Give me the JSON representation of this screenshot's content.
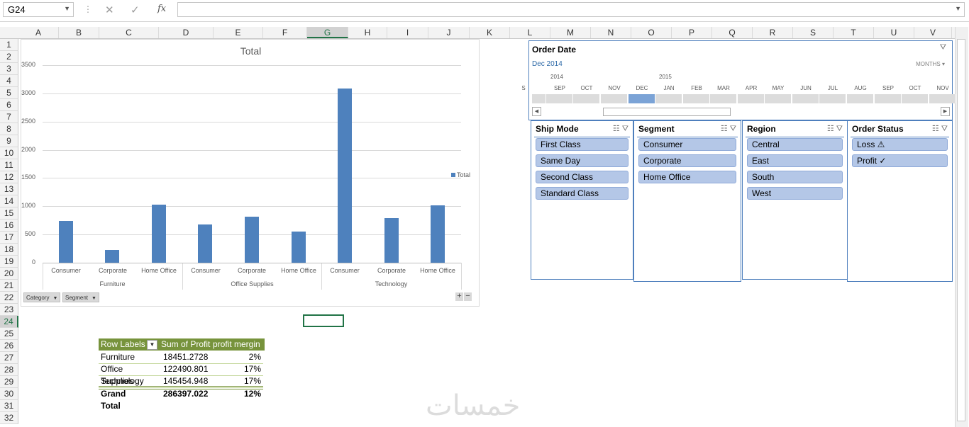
{
  "namebox": {
    "value": "G24"
  },
  "formula_bar": {
    "cancel_icon": "✕",
    "enter_icon": "✓",
    "fx_label": "fx",
    "value": ""
  },
  "columns": [
    "A",
    "B",
    "C",
    "D",
    "E",
    "F",
    "G",
    "H",
    "I",
    "J",
    "K",
    "L",
    "M",
    "N",
    "O",
    "P",
    "Q",
    "R",
    "S",
    "T",
    "U",
    "V"
  ],
  "rows": [
    "1",
    "2",
    "3",
    "4",
    "5",
    "6",
    "7",
    "8",
    "9",
    "10",
    "11",
    "12",
    "13",
    "14",
    "15",
    "16",
    "17",
    "18",
    "19",
    "20",
    "21",
    "22",
    "23",
    "24",
    "25",
    "26",
    "27",
    "28",
    "29",
    "30",
    "31",
    "32"
  ],
  "selected": {
    "column": "G",
    "row": "24"
  },
  "chart": {
    "title": "Total",
    "legend": "Total",
    "field_buttons": [
      "Category",
      "Segment"
    ],
    "zoom_plus": "+",
    "zoom_minus": "−"
  },
  "chart_data": {
    "type": "bar",
    "title": "Total",
    "groups": [
      "Furniture",
      "Office Supplies",
      "Technology"
    ],
    "categories": [
      "Consumer",
      "Corporate",
      "Home Office",
      "Consumer",
      "Corporate",
      "Home Office",
      "Consumer",
      "Corporate",
      "Home Office"
    ],
    "series": [
      {
        "name": "Total",
        "values": [
          740,
          220,
          1030,
          675,
          815,
          550,
          3080,
          795,
          1020
        ]
      }
    ],
    "ylim": [
      0,
      3500
    ],
    "yticks": [
      "0",
      "500",
      "1000",
      "1500",
      "2000",
      "2500",
      "3000",
      "3500"
    ],
    "grid": true,
    "legend_position": "right",
    "color": "#4e81bd"
  },
  "timeline": {
    "title": "Order Date",
    "range_label": "Dec 2014",
    "level_label": "MONTHS",
    "years": [
      "2014",
      "2015"
    ],
    "months": [
      "S",
      "SEP",
      "OCT",
      "NOV",
      "DEC",
      "JAN",
      "FEB",
      "MAR",
      "APR",
      "MAY",
      "JUN",
      "JUL",
      "AUG",
      "SEP",
      "OCT",
      "NOV"
    ],
    "selected_month": "DEC"
  },
  "slicers": [
    {
      "title": "Ship Mode",
      "items": [
        "First Class",
        "Same Day",
        "Second Class",
        "Standard Class"
      ]
    },
    {
      "title": "Segment",
      "items": [
        "Consumer",
        "Corporate",
        "Home Office"
      ]
    },
    {
      "title": "Region",
      "items": [
        "Central",
        "East",
        "South",
        "West"
      ]
    },
    {
      "title": "Order Status",
      "items": [
        "Loss ⚠",
        "Profit ✓"
      ]
    }
  ],
  "pivot": {
    "headers": [
      "Row Labels",
      "Sum of Profit",
      "profit mergin"
    ],
    "rows": [
      [
        "Furniture",
        "18451.2728",
        "2%"
      ],
      [
        "Office Supplies",
        "122490.801",
        "17%"
      ],
      [
        "Technology",
        "145454.948",
        "17%"
      ]
    ],
    "total": [
      "Grand Total",
      "286397.022",
      "12%"
    ]
  },
  "watermark": "خمسات"
}
